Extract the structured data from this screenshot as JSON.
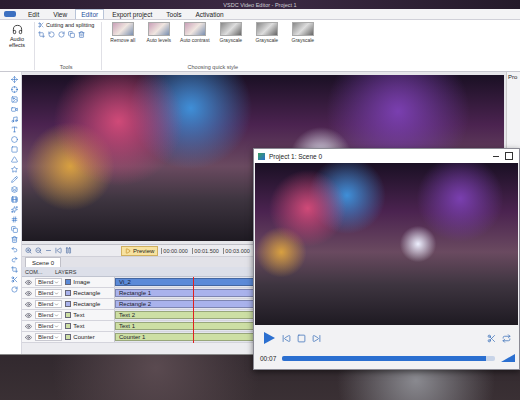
{
  "main_window": {
    "title": "VSDC Video Editor - Project 1"
  },
  "menu": [
    {
      "label": "Edit",
      "selected": false
    },
    {
      "label": "View",
      "selected": false
    },
    {
      "label": "Editor",
      "selected": true
    },
    {
      "label": "Export project",
      "selected": false
    },
    {
      "label": "Tools",
      "selected": false
    },
    {
      "label": "Activation",
      "selected": false
    }
  ],
  "ribbon": {
    "audio_effects": "Audio effects",
    "cutting": "Cutting and splitting",
    "tools_label": "Tools",
    "quick_style_label": "Choosing quick style",
    "quick_styles": [
      "Remove all",
      "Auto levels",
      "Auto contrast",
      "Grayscale",
      "Grayscale",
      "Grayscale"
    ]
  },
  "properties_panel": {
    "title": "Pro"
  },
  "timeline": {
    "preview_button": "Preview",
    "scene_tab": "Scene 0",
    "columns": [
      "COM...",
      "LAYERS"
    ],
    "ticks": [
      "00:00.000",
      "00:01.500",
      "00:03.000"
    ],
    "playhead": 0.19,
    "rows": [
      {
        "blend": "Blend",
        "type": "Image",
        "clip": "Vi_2",
        "color": "#5b8ad8"
      },
      {
        "blend": "Blend",
        "type": "Rectangle",
        "clip": "Rectangle 1",
        "color": "#a9b2ec"
      },
      {
        "blend": "Blend",
        "type": "Rectangle",
        "clip": "Rectangle 2",
        "color": "#a9b2ec"
      },
      {
        "blend": "Blend",
        "type": "Text",
        "clip": "Text 2",
        "color": "#cddfa4"
      },
      {
        "blend": "Blend",
        "type": "Text",
        "clip": "Text 1",
        "color": "#cddfa4"
      },
      {
        "blend": "Blend",
        "type": "Counter",
        "clip": "Counter 1",
        "color": "#cddfa4"
      }
    ]
  },
  "preview_window": {
    "title": "Project 1: Scene 0",
    "time": "00:07",
    "level": 0.96
  }
}
